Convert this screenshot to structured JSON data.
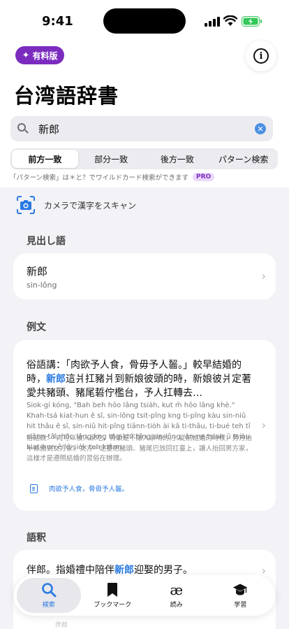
{
  "status": {
    "time": "9:41"
  },
  "header": {
    "pro_label": "有料版",
    "title": "台湾語辞書"
  },
  "search": {
    "value": "新郎",
    "placeholder": ""
  },
  "segments": [
    {
      "label": "前方一致",
      "active": true
    },
    {
      "label": "部分一致",
      "active": false
    },
    {
      "label": "後方一致",
      "active": false
    },
    {
      "label": "パターン検索",
      "active": false
    }
  ],
  "hint": {
    "text": "「パターン検索」は＊と？でワイルドカード検索ができます",
    "badge": "PRO"
  },
  "camera": {
    "label": "カメラで漢字をスキャン"
  },
  "headwords": {
    "section_title": "見出し語",
    "items": [
      {
        "title": "新郎",
        "romanization": "sin-lông"
      }
    ]
  },
  "examples": {
    "section_title": "例文",
    "items": [
      {
        "han_before": "俗語講：「肉欲予人食，骨毋予人齧。」較早結婚的時，",
        "han_highlight": "新郎",
        "han_after": "這爿扛豬爿到新娘彼頭的時，新娘彼爿定著愛共豬頭、豬尾硩佇檻台，予人扛轉去…",
        "romanization": "Siok-gí kóng, \"Bah beh hōo lâng tsia̍h, kut m̄ hōo lâng khè.\" Khah-tsá kiat-hun ê sî, sin-lông tsit-pîng kng ti-pîng kàu sin-niû hit thâu ê sî, sin-niû hit-pîng tiānn-tio̍h ài kā ti-thâu, ti-bué teh tī siānn-tâi, hōo lâng kng tńg-khì hīng sin-lông, án-ne tsiah ū tsiàu kiat-hun ê lé-sio̍k teh kiânn.",
        "explanation": "俗話說：「肉可以被人家吃，骨頭是不讓人家啃的。」從前結婚的時候，男方抬半條豬到女方家，女方一定要把豬頭、豬尾巴放回扛臺上，讓人抬回男方家，這樣才是遵照結婚的習俗在辦理。",
        "source": "肉欲予人食，骨毋予人齧。"
      }
    ]
  },
  "definitions": {
    "section_title": "語釈",
    "items": [
      {
        "text_before": "伴郎。指婚禮中陪伴",
        "text_highlight": "新郎",
        "text_after": "迎娶的男子。"
      }
    ],
    "faint_lines": [
      "……",
      "n̄i-.......................",
      "伴郎"
    ]
  },
  "tabbar": [
    {
      "label": "検索",
      "icon": "search-icon",
      "active": true
    },
    {
      "label": "ブックマーク",
      "icon": "bookmark-icon",
      "active": false
    },
    {
      "label": "読み",
      "icon": "ae-icon",
      "active": false
    },
    {
      "label": "学習",
      "icon": "graduation-cap-icon",
      "active": false
    }
  ],
  "colors": {
    "accent": "#2a7ae2",
    "pro": "#7b2cbf",
    "background": "#f2f2f7"
  }
}
